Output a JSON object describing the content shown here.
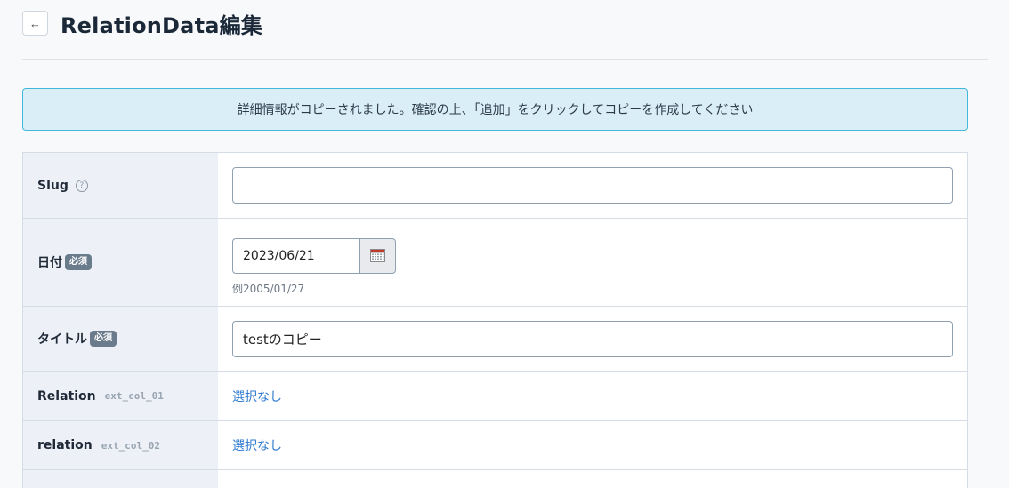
{
  "header": {
    "back_label": "←",
    "title": "RelationData編集"
  },
  "notice": {
    "text": "詳細情報がコピーされました。確認の上、「追加」をクリックしてコピーを作成してください"
  },
  "form": {
    "slug": {
      "label": "Slug",
      "help": "?",
      "value": ""
    },
    "date": {
      "label": "日付",
      "badge": "必須",
      "value": "2023/06/21",
      "example": "例2005/01/27"
    },
    "title": {
      "label": "タイトル",
      "badge": "必須",
      "value": "testのコピー"
    },
    "relation1": {
      "label": "Relation",
      "hint": "ext_col_01",
      "value": "選択なし"
    },
    "relation2": {
      "label": "relation",
      "hint": "ext_col_02",
      "value": "選択なし"
    }
  }
}
